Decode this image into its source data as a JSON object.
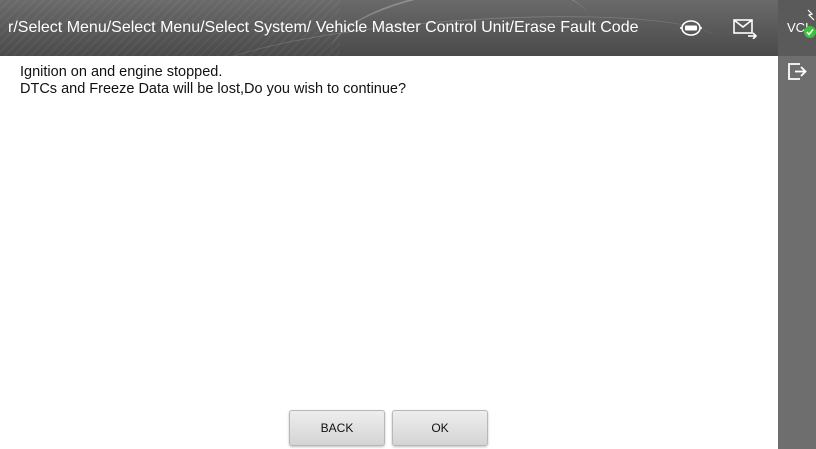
{
  "header": {
    "breadcrumb": "r/Select Menu/Select Menu/Select System/ Vehicle Master Control Unit/Erase Fault Code",
    "obd_icon": "obd-icon",
    "mail_icon": "mail-icon"
  },
  "right_bar": {
    "vci_label": "VCI",
    "vci_status_color": "#3cc23c",
    "exit_icon": "exit-icon"
  },
  "message": {
    "line1": "Ignition on and engine stopped.",
    "line2": "DTCs and Freeze Data will be lost,Do you wish to continue?"
  },
  "buttons": {
    "back_label": "BACK",
    "ok_label": "OK"
  },
  "colors": {
    "header_bg": "#555555",
    "side_bar_bg": "#6e6e6e",
    "content_bg": "#ffffff"
  }
}
